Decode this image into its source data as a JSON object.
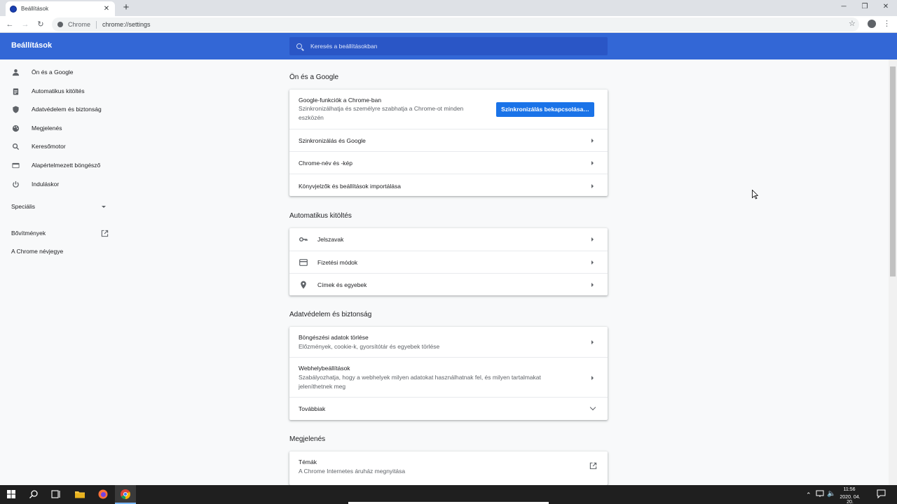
{
  "browser": {
    "tab_title": "Beállítások",
    "omnibox_label": "Chrome",
    "url": "chrome://settings"
  },
  "header": {
    "title": "Beállítások",
    "search_placeholder": "Keresés a beállításokban"
  },
  "sidebar": {
    "items": [
      {
        "label": "Ön és a Google",
        "icon": "person-icon"
      },
      {
        "label": "Automatikus kitöltés",
        "icon": "clipboard-icon"
      },
      {
        "label": "Adatvédelem és biztonság",
        "icon": "shield-icon"
      },
      {
        "label": "Megjelenés",
        "icon": "palette-icon"
      },
      {
        "label": "Keresőmotor",
        "icon": "search-icon"
      },
      {
        "label": "Alapértelmezett böngésző",
        "icon": "browser-icon"
      },
      {
        "label": "Induláskor",
        "icon": "power-icon"
      }
    ],
    "advanced": "Speciális",
    "extensions": "Bővítmények",
    "about": "A Chrome névjegye"
  },
  "sections": {
    "you_google": {
      "title": "Ön és a Google",
      "google_features_title": "Google-funkciók a Chrome-ban",
      "google_features_sub": "Szinkronizálhatja és személyre szabhatja a Chrome-ot minden eszközén",
      "sync_button": "Szinkronizálás bekapcsolása…",
      "rows": [
        "Szinkronizálás és Google",
        "Chrome-név és -kép",
        "Könyvjelzők és beállítások importálása"
      ]
    },
    "autofill": {
      "title": "Automatikus kitöltés",
      "rows": [
        {
          "label": "Jelszavak",
          "icon": "key-icon"
        },
        {
          "label": "Fizetési módok",
          "icon": "credit-card-icon"
        },
        {
          "label": "Címek és egyebek",
          "icon": "location-pin-icon"
        }
      ]
    },
    "privacy": {
      "title": "Adatvédelem és biztonság",
      "clear_title": "Böngészési adatok törlése",
      "clear_sub": "Előzmények, cookie-k, gyorsítótár és egyebek törlése",
      "site_title": "Webhelybeállítások",
      "site_sub": "Szabályozhatja, hogy a webhelyek milyen adatokat használhatnak fel, és milyen tartalmakat jeleníthetnek meg",
      "more": "Továbbiak"
    },
    "appearance": {
      "title": "Megjelenés",
      "themes_title": "Témák",
      "themes_sub": "A Chrome Internetes áruház megnyitása"
    }
  },
  "taskbar": {
    "time": "11:56",
    "date": "2020. 04. 20."
  },
  "colors": {
    "header_blue": "#3367d6",
    "button_blue": "#1a73e8"
  }
}
